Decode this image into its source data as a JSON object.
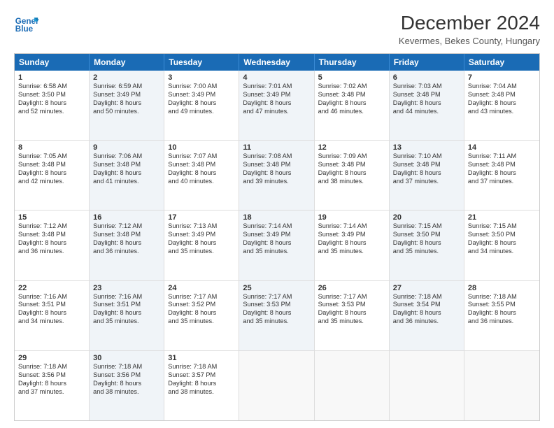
{
  "header": {
    "logo_line1": "General",
    "logo_line2": "Blue",
    "title": "December 2024",
    "subtitle": "Kevermes, Bekes County, Hungary"
  },
  "calendar": {
    "days_of_week": [
      "Sunday",
      "Monday",
      "Tuesday",
      "Wednesday",
      "Thursday",
      "Friday",
      "Saturday"
    ],
    "rows": [
      [
        {
          "day": "1",
          "lines": [
            "Sunrise: 6:58 AM",
            "Sunset: 3:50 PM",
            "Daylight: 8 hours",
            "and 52 minutes."
          ],
          "empty": false,
          "shaded": false
        },
        {
          "day": "2",
          "lines": [
            "Sunrise: 6:59 AM",
            "Sunset: 3:49 PM",
            "Daylight: 8 hours",
            "and 50 minutes."
          ],
          "empty": false,
          "shaded": true
        },
        {
          "day": "3",
          "lines": [
            "Sunrise: 7:00 AM",
            "Sunset: 3:49 PM",
            "Daylight: 8 hours",
            "and 49 minutes."
          ],
          "empty": false,
          "shaded": false
        },
        {
          "day": "4",
          "lines": [
            "Sunrise: 7:01 AM",
            "Sunset: 3:49 PM",
            "Daylight: 8 hours",
            "and 47 minutes."
          ],
          "empty": false,
          "shaded": true
        },
        {
          "day": "5",
          "lines": [
            "Sunrise: 7:02 AM",
            "Sunset: 3:48 PM",
            "Daylight: 8 hours",
            "and 46 minutes."
          ],
          "empty": false,
          "shaded": false
        },
        {
          "day": "6",
          "lines": [
            "Sunrise: 7:03 AM",
            "Sunset: 3:48 PM",
            "Daylight: 8 hours",
            "and 44 minutes."
          ],
          "empty": false,
          "shaded": true
        },
        {
          "day": "7",
          "lines": [
            "Sunrise: 7:04 AM",
            "Sunset: 3:48 PM",
            "Daylight: 8 hours",
            "and 43 minutes."
          ],
          "empty": false,
          "shaded": false
        }
      ],
      [
        {
          "day": "8",
          "lines": [
            "Sunrise: 7:05 AM",
            "Sunset: 3:48 PM",
            "Daylight: 8 hours",
            "and 42 minutes."
          ],
          "empty": false,
          "shaded": false
        },
        {
          "day": "9",
          "lines": [
            "Sunrise: 7:06 AM",
            "Sunset: 3:48 PM",
            "Daylight: 8 hours",
            "and 41 minutes."
          ],
          "empty": false,
          "shaded": true
        },
        {
          "day": "10",
          "lines": [
            "Sunrise: 7:07 AM",
            "Sunset: 3:48 PM",
            "Daylight: 8 hours",
            "and 40 minutes."
          ],
          "empty": false,
          "shaded": false
        },
        {
          "day": "11",
          "lines": [
            "Sunrise: 7:08 AM",
            "Sunset: 3:48 PM",
            "Daylight: 8 hours",
            "and 39 minutes."
          ],
          "empty": false,
          "shaded": true
        },
        {
          "day": "12",
          "lines": [
            "Sunrise: 7:09 AM",
            "Sunset: 3:48 PM",
            "Daylight: 8 hours",
            "and 38 minutes."
          ],
          "empty": false,
          "shaded": false
        },
        {
          "day": "13",
          "lines": [
            "Sunrise: 7:10 AM",
            "Sunset: 3:48 PM",
            "Daylight: 8 hours",
            "and 37 minutes."
          ],
          "empty": false,
          "shaded": true
        },
        {
          "day": "14",
          "lines": [
            "Sunrise: 7:11 AM",
            "Sunset: 3:48 PM",
            "Daylight: 8 hours",
            "and 37 minutes."
          ],
          "empty": false,
          "shaded": false
        }
      ],
      [
        {
          "day": "15",
          "lines": [
            "Sunrise: 7:12 AM",
            "Sunset: 3:48 PM",
            "Daylight: 8 hours",
            "and 36 minutes."
          ],
          "empty": false,
          "shaded": false
        },
        {
          "day": "16",
          "lines": [
            "Sunrise: 7:12 AM",
            "Sunset: 3:48 PM",
            "Daylight: 8 hours",
            "and 36 minutes."
          ],
          "empty": false,
          "shaded": true
        },
        {
          "day": "17",
          "lines": [
            "Sunrise: 7:13 AM",
            "Sunset: 3:49 PM",
            "Daylight: 8 hours",
            "and 35 minutes."
          ],
          "empty": false,
          "shaded": false
        },
        {
          "day": "18",
          "lines": [
            "Sunrise: 7:14 AM",
            "Sunset: 3:49 PM",
            "Daylight: 8 hours",
            "and 35 minutes."
          ],
          "empty": false,
          "shaded": true
        },
        {
          "day": "19",
          "lines": [
            "Sunrise: 7:14 AM",
            "Sunset: 3:49 PM",
            "Daylight: 8 hours",
            "and 35 minutes."
          ],
          "empty": false,
          "shaded": false
        },
        {
          "day": "20",
          "lines": [
            "Sunrise: 7:15 AM",
            "Sunset: 3:50 PM",
            "Daylight: 8 hours",
            "and 35 minutes."
          ],
          "empty": false,
          "shaded": true
        },
        {
          "day": "21",
          "lines": [
            "Sunrise: 7:15 AM",
            "Sunset: 3:50 PM",
            "Daylight: 8 hours",
            "and 34 minutes."
          ],
          "empty": false,
          "shaded": false
        }
      ],
      [
        {
          "day": "22",
          "lines": [
            "Sunrise: 7:16 AM",
            "Sunset: 3:51 PM",
            "Daylight: 8 hours",
            "and 34 minutes."
          ],
          "empty": false,
          "shaded": false
        },
        {
          "day": "23",
          "lines": [
            "Sunrise: 7:16 AM",
            "Sunset: 3:51 PM",
            "Daylight: 8 hours",
            "and 35 minutes."
          ],
          "empty": false,
          "shaded": true
        },
        {
          "day": "24",
          "lines": [
            "Sunrise: 7:17 AM",
            "Sunset: 3:52 PM",
            "Daylight: 8 hours",
            "and 35 minutes."
          ],
          "empty": false,
          "shaded": false
        },
        {
          "day": "25",
          "lines": [
            "Sunrise: 7:17 AM",
            "Sunset: 3:53 PM",
            "Daylight: 8 hours",
            "and 35 minutes."
          ],
          "empty": false,
          "shaded": true
        },
        {
          "day": "26",
          "lines": [
            "Sunrise: 7:17 AM",
            "Sunset: 3:53 PM",
            "Daylight: 8 hours",
            "and 35 minutes."
          ],
          "empty": false,
          "shaded": false
        },
        {
          "day": "27",
          "lines": [
            "Sunrise: 7:18 AM",
            "Sunset: 3:54 PM",
            "Daylight: 8 hours",
            "and 36 minutes."
          ],
          "empty": false,
          "shaded": true
        },
        {
          "day": "28",
          "lines": [
            "Sunrise: 7:18 AM",
            "Sunset: 3:55 PM",
            "Daylight: 8 hours",
            "and 36 minutes."
          ],
          "empty": false,
          "shaded": false
        }
      ],
      [
        {
          "day": "29",
          "lines": [
            "Sunrise: 7:18 AM",
            "Sunset: 3:56 PM",
            "Daylight: 8 hours",
            "and 37 minutes."
          ],
          "empty": false,
          "shaded": false
        },
        {
          "day": "30",
          "lines": [
            "Sunrise: 7:18 AM",
            "Sunset: 3:56 PM",
            "Daylight: 8 hours",
            "and 38 minutes."
          ],
          "empty": false,
          "shaded": true
        },
        {
          "day": "31",
          "lines": [
            "Sunrise: 7:18 AM",
            "Sunset: 3:57 PM",
            "Daylight: 8 hours",
            "and 38 minutes."
          ],
          "empty": false,
          "shaded": false
        },
        {
          "day": "",
          "lines": [],
          "empty": true,
          "shaded": true
        },
        {
          "day": "",
          "lines": [],
          "empty": true,
          "shaded": false
        },
        {
          "day": "",
          "lines": [],
          "empty": true,
          "shaded": true
        },
        {
          "day": "",
          "lines": [],
          "empty": true,
          "shaded": false
        }
      ]
    ]
  }
}
